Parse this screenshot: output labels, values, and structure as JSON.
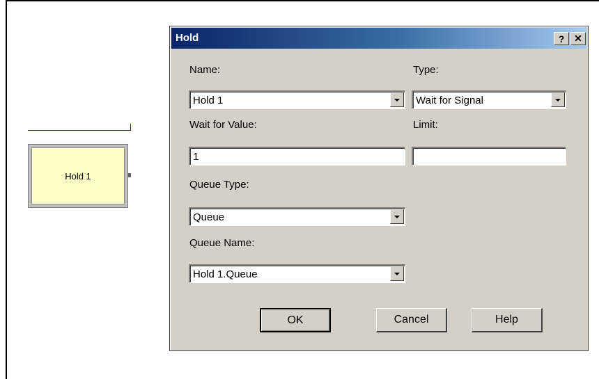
{
  "canvas": {
    "module_label": "Hold 1"
  },
  "dialog": {
    "title": "Hold",
    "help_button": "?",
    "close_button": "✕",
    "fields": {
      "name": {
        "label": "Name:",
        "value": "Hold 1"
      },
      "type": {
        "label": "Type:",
        "value": "Wait for Signal"
      },
      "wait_for_value": {
        "label": "Wait for Value:",
        "value": "1"
      },
      "limit": {
        "label": "Limit:",
        "value": ""
      },
      "queue_type": {
        "label": "Queue Type:",
        "value": "Queue"
      },
      "queue_name": {
        "label": "Queue Name:",
        "value": "Hold 1.Queue"
      }
    },
    "buttons": {
      "ok": "OK",
      "cancel": "Cancel",
      "help": "Help"
    }
  }
}
